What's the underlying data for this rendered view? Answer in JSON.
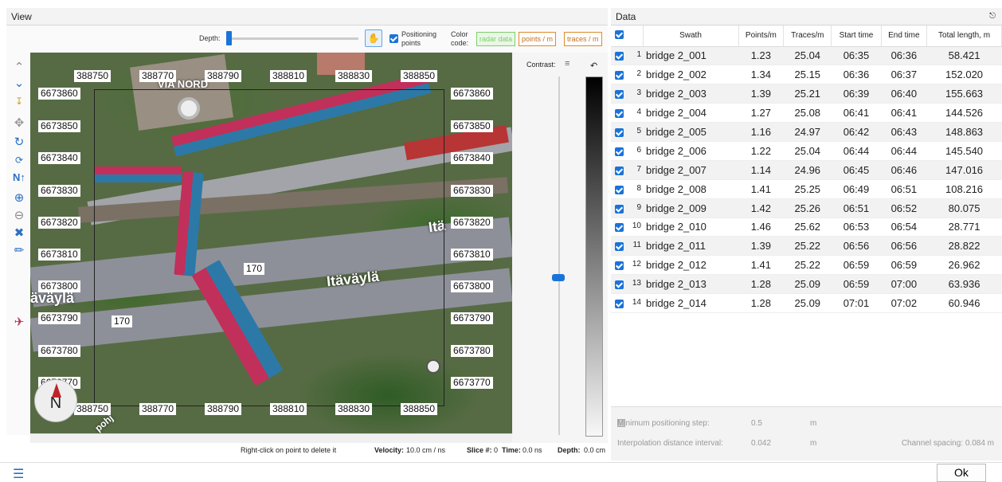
{
  "view": {
    "title": "View"
  },
  "toolbar": {
    "depth_label": "Depth:",
    "positioning_label": "Positioning points",
    "color_code_label": "Color code:",
    "color_buttons": [
      {
        "label": "radar data",
        "color": "#7ccf6a"
      },
      {
        "label": "points / m",
        "color": "#e08a2c"
      },
      {
        "label": "traces / m",
        "color": "#e08a2c"
      }
    ]
  },
  "map": {
    "x_labels": [
      "388750",
      "388770",
      "388790",
      "388810",
      "388830",
      "388850"
    ],
    "y_labels": [
      "6673860",
      "6673850",
      "6673840",
      "6673830",
      "6673820",
      "6673810",
      "6673800",
      "6673790",
      "6673780",
      "6673770"
    ],
    "text_via_nord": "VIA NORD",
    "text_itavayla": "Itäväylä",
    "text_itavayla_left": "äväylä",
    "text_itav_right": "Itä",
    "text_pohj": "pohj",
    "speed_label_1": "170",
    "speed_label_2": "170",
    "compass_label": "N",
    "colors": {
      "red_swath": "#c0305a",
      "blue_swath": "#2c79a8"
    }
  },
  "contrast": {
    "label": "Contrast:",
    "level": 0.56
  },
  "status": {
    "hint": "Right-click on point to delete it",
    "velocity_label": "Velocity:",
    "velocity_value": "10.0 cm / ns",
    "slice_label": "Slice #:",
    "slice_value": "0",
    "time_label": "Time:",
    "time_value": "0.0 ns",
    "depth_label": "Depth:",
    "depth_value": "0.0 cm"
  },
  "data_panel": {
    "title": "Data",
    "columns": [
      "Swath",
      "Points/m",
      "Traces/m",
      "Start time",
      "End time",
      "Total length, m"
    ],
    "rows": [
      {
        "i": "1",
        "swath": "bridge 2_001",
        "pts": "1.23",
        "trc": "25.04",
        "start": "06:35",
        "end": "06:36",
        "len": "58.421"
      },
      {
        "i": "2",
        "swath": "bridge 2_002",
        "pts": "1.34",
        "trc": "25.15",
        "start": "06:36",
        "end": "06:37",
        "len": "152.020"
      },
      {
        "i": "3",
        "swath": "bridge 2_003",
        "pts": "1.39",
        "trc": "25.21",
        "start": "06:39",
        "end": "06:40",
        "len": "155.663"
      },
      {
        "i": "4",
        "swath": "bridge 2_004",
        "pts": "1.27",
        "trc": "25.08",
        "start": "06:41",
        "end": "06:41",
        "len": "144.526"
      },
      {
        "i": "5",
        "swath": "bridge 2_005",
        "pts": "1.16",
        "trc": "24.97",
        "start": "06:42",
        "end": "06:43",
        "len": "148.863"
      },
      {
        "i": "6",
        "swath": "bridge 2_006",
        "pts": "1.22",
        "trc": "25.04",
        "start": "06:44",
        "end": "06:44",
        "len": "145.540"
      },
      {
        "i": "7",
        "swath": "bridge 2_007",
        "pts": "1.14",
        "trc": "24.96",
        "start": "06:45",
        "end": "06:46",
        "len": "147.016"
      },
      {
        "i": "8",
        "swath": "bridge 2_008",
        "pts": "1.41",
        "trc": "25.25",
        "start": "06:49",
        "end": "06:51",
        "len": "108.216"
      },
      {
        "i": "9",
        "swath": "bridge 2_009",
        "pts": "1.42",
        "trc": "25.26",
        "start": "06:51",
        "end": "06:52",
        "len": "80.075"
      },
      {
        "i": "10",
        "swath": "bridge 2_010",
        "pts": "1.46",
        "trc": "25.62",
        "start": "06:53",
        "end": "06:54",
        "len": "28.771"
      },
      {
        "i": "11",
        "swath": "bridge 2_011",
        "pts": "1.39",
        "trc": "25.22",
        "start": "06:56",
        "end": "06:56",
        "len": "28.822"
      },
      {
        "i": "12",
        "swath": "bridge 2_012",
        "pts": "1.41",
        "trc": "25.22",
        "start": "06:59",
        "end": "06:59",
        "len": "26.962"
      },
      {
        "i": "13",
        "swath": "bridge 2_013",
        "pts": "1.28",
        "trc": "25.09",
        "start": "06:59",
        "end": "07:00",
        "len": "63.936"
      },
      {
        "i": "14",
        "swath": "bridge 2_014",
        "pts": "1.28",
        "trc": "25.09",
        "start": "07:01",
        "end": "07:02",
        "len": "60.946"
      }
    ],
    "min_step_label": "Minimum positioning step:",
    "min_step_value": "0.5",
    "min_step_unit": "m",
    "interp_label": "Interpolation distance interval:",
    "interp_value": "0.042",
    "interp_unit": "m",
    "channel_spacing": "Channel spacing: 0.084 m"
  },
  "footer": {
    "ok_label": "Ok"
  }
}
